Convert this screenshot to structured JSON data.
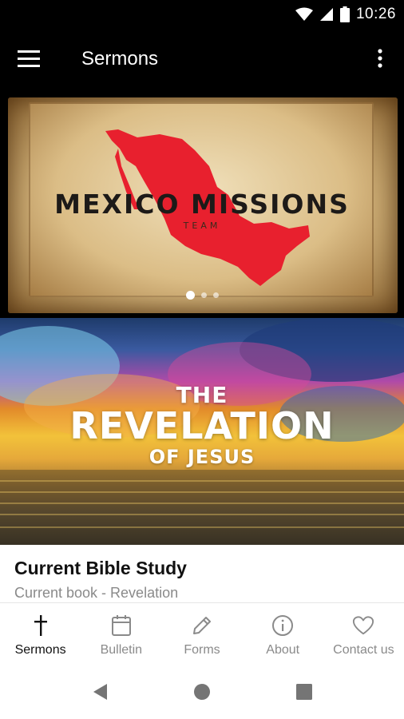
{
  "status_bar": {
    "time": "10:26"
  },
  "app_bar": {
    "title": "Sermons"
  },
  "carousel": {
    "title": "MEXICO MISSIONS",
    "subtitle": "TEAM",
    "total_slides": 3,
    "active_slide": 1
  },
  "study": {
    "image_line1": "THE",
    "image_line2": "REVELATION",
    "image_line3": "OF JESUS",
    "title": "Current Bible Study",
    "subtitle": "Current book - Revelation"
  },
  "bottom_nav": {
    "items": [
      {
        "label": "Sermons",
        "icon": "cross-icon",
        "active": true
      },
      {
        "label": "Bulletin",
        "icon": "calendar-icon",
        "active": false
      },
      {
        "label": "Forms",
        "icon": "pencil-icon",
        "active": false
      },
      {
        "label": "About",
        "icon": "info-icon",
        "active": false
      },
      {
        "label": "Contact us",
        "icon": "heart-icon",
        "active": false
      }
    ]
  },
  "colors": {
    "accent_map": "#e8202e",
    "nav_active": "#111111",
    "nav_inactive": "#8a8a8a"
  }
}
